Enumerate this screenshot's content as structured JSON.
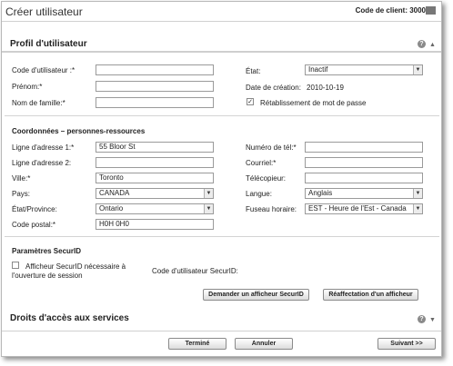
{
  "window": {
    "title": "Créer utilisateur",
    "client_label": "Code de client: 3000"
  },
  "profile": {
    "heading": "Profil d'utilisateur",
    "user_code_label": "Code d'utilisateur :*",
    "user_code_value": "",
    "first_name_label": "Prénom:*",
    "first_name_value": "",
    "last_name_label": "Nom de famille:*",
    "last_name_value": "",
    "state_label": "État:",
    "state_value": "Inactif",
    "creation_date_label": "Date de création:",
    "creation_date_value": "2010-10-19",
    "password_reset_label": "Rétablissement de mot de passe",
    "password_reset_checked": true
  },
  "contact": {
    "heading": "Coordonnées – personnes-ressources",
    "address1_label": "Ligne d'adresse 1:*",
    "address1_value": "55 Bloor St",
    "address2_label": "Ligne d'adresse 2:",
    "address2_value": "",
    "city_label": "Ville:*",
    "city_value": "Toronto",
    "country_label": "Pays:",
    "country_value": "CANADA",
    "province_label": "État/Province:",
    "province_value": "Ontario",
    "postal_label": "Code postal:*",
    "postal_value": "H0H 0H0",
    "phone_label": "Numéro de tél:*",
    "phone_value": "",
    "email_label": "Courriel:*",
    "email_value": "",
    "fax_label": "Télécopieur:",
    "fax_value": "",
    "language_label": "Langue:",
    "language_value": "Anglais",
    "timezone_label": "Fuseau horaire:",
    "timezone_value": "EST - Heure de l'Est - Canada"
  },
  "securid": {
    "heading": "Paramètres SecurID",
    "checkbox_label_line1": "Afficheur SecurID nécessaire à",
    "checkbox_label_line2": "l'ouverture de session",
    "checked": false,
    "user_code_label": "Code d'utilisateur SecurID:",
    "request_button": "Demander un afficheur SecurID",
    "reassign_button": "Réaffectation d'un afficheur"
  },
  "services": {
    "heading": "Droits d'accès aux services"
  },
  "footer": {
    "done_button": "Terminé",
    "cancel_button": "Annuler",
    "next_button": "Suivant >>"
  },
  "icons": {
    "help": "help-icon",
    "collapse": "collapse-caret-icon",
    "dropdown": "dropdown-arrow-icon",
    "check": "checkmark-icon"
  }
}
